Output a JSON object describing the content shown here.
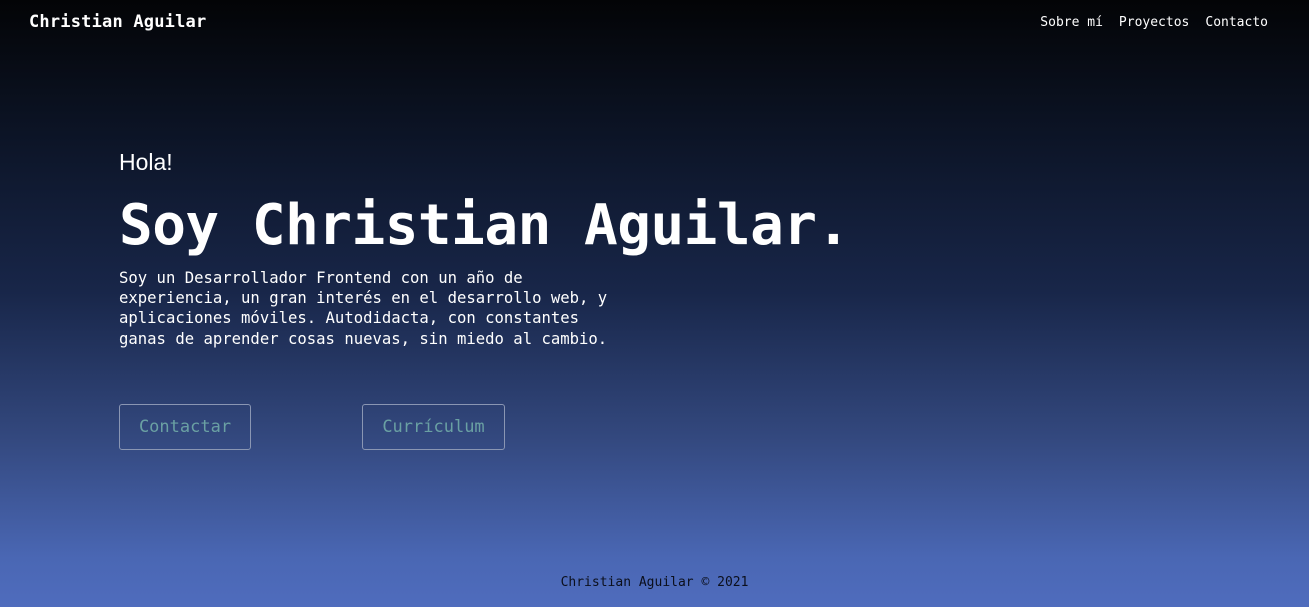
{
  "header": {
    "brand": "Christian Aguilar",
    "nav": [
      {
        "label": "Sobre mí"
      },
      {
        "label": "Proyectos"
      },
      {
        "label": "Contacto"
      }
    ]
  },
  "hero": {
    "greeting": "Hola!",
    "headline": "Soy Christian Aguilar.",
    "intro": "Soy un Desarrollador Frontend con un año de experiencia, un gran interés en el desarrollo web, y aplicaciones móviles. Autodidacta, con constantes ganas de aprender cosas nuevas, sin miedo al cambio.",
    "buttons": {
      "contact": "Contactar",
      "cv": "Currículum"
    }
  },
  "footer": {
    "text": "Christian Aguilar © 2021"
  },
  "colors": {
    "button_text": "#6aa0a3",
    "gradient_top": "#030406",
    "gradient_bottom": "#4f6cbd"
  }
}
